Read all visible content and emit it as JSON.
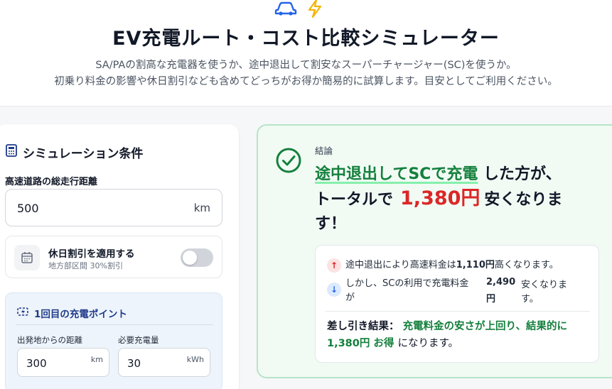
{
  "header": {
    "title": "EV充電ルート・コスト比較シミュレーター",
    "subtitle_line1": "SA/PAの割高な充電器を使うか、途中退出して割安なスーパーチャージャー(SC)を使うか。",
    "subtitle_line2": "初乗り料金の影響や休日割引なども含めてどっちがお得か簡易的に試算します。目安としてご利用ください。",
    "icons": [
      "car-icon",
      "lightning-icon"
    ]
  },
  "conditions": {
    "heading": "シミュレーション条件",
    "heading_icon": "calculator-icon",
    "distance_label": "高速道路の総走行距離",
    "distance_value": "500",
    "distance_unit": "km",
    "holiday_title": "休日割引を適用する",
    "holiday_sub": "地方部区間 30%割引",
    "holiday_enabled": false,
    "charge_point": {
      "heading": "1回目の充電ポイント",
      "from_start_label": "出発地からの距離",
      "from_start_value": "300",
      "from_start_unit": "km",
      "required_label": "必要充電量",
      "required_value": "30",
      "required_unit": "kWh"
    }
  },
  "conclusion": {
    "label": "結論",
    "highlight": "途中退出してSCで充電",
    "text_after_highlight": " した方が、",
    "total_prefix": "トータルで",
    "savings": "1,380円",
    "text_after_savings": "安くなりま",
    "text_end": "す！",
    "detail": {
      "row1_before": "途中退出により高速料金は",
      "row1_amount": "1,110円",
      "row1_after": "高くなります。",
      "row2_text": "しかし、SCの利用で充電料金が",
      "row2_amount_a": "2,490",
      "row2_amount_b": "円",
      "row2_after_a": "安くなりま",
      "row2_after_b": "す。",
      "result_label": "差し引き結果：",
      "result_green_a": "充電料金の安さが上回り、結果的に",
      "result_green_b": "1,380円 お得",
      "result_end": "になります。"
    }
  },
  "colors": {
    "accent_blue": "#1e3a8a",
    "success_green": "#15803d",
    "savings_red": "#dc2626",
    "icon_yellow": "#f5b301"
  }
}
